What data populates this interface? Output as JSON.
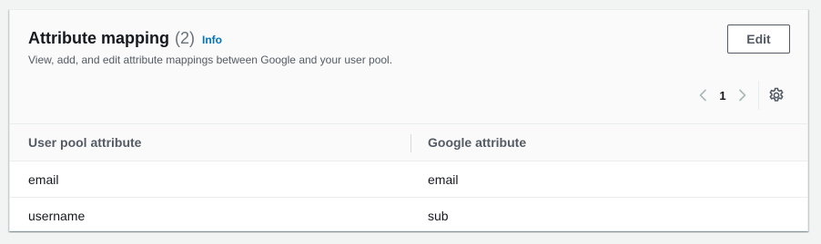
{
  "header": {
    "title": "Attribute mapping",
    "count": "(2)",
    "info_label": "Info",
    "description": "View, add, and edit attribute mappings between Google and your user pool.",
    "edit_label": "Edit"
  },
  "pagination": {
    "current_page": "1",
    "prev_icon": "chevron-left-icon",
    "next_icon": "chevron-right-icon",
    "settings_icon": "gear-icon"
  },
  "table": {
    "columns": [
      "User pool attribute",
      "Google attribute"
    ],
    "rows": [
      [
        "email",
        "email"
      ],
      [
        "username",
        "sub"
      ]
    ]
  },
  "colors": {
    "link": "#0073bb",
    "text": "#16191f",
    "muted": "#545b64"
  }
}
